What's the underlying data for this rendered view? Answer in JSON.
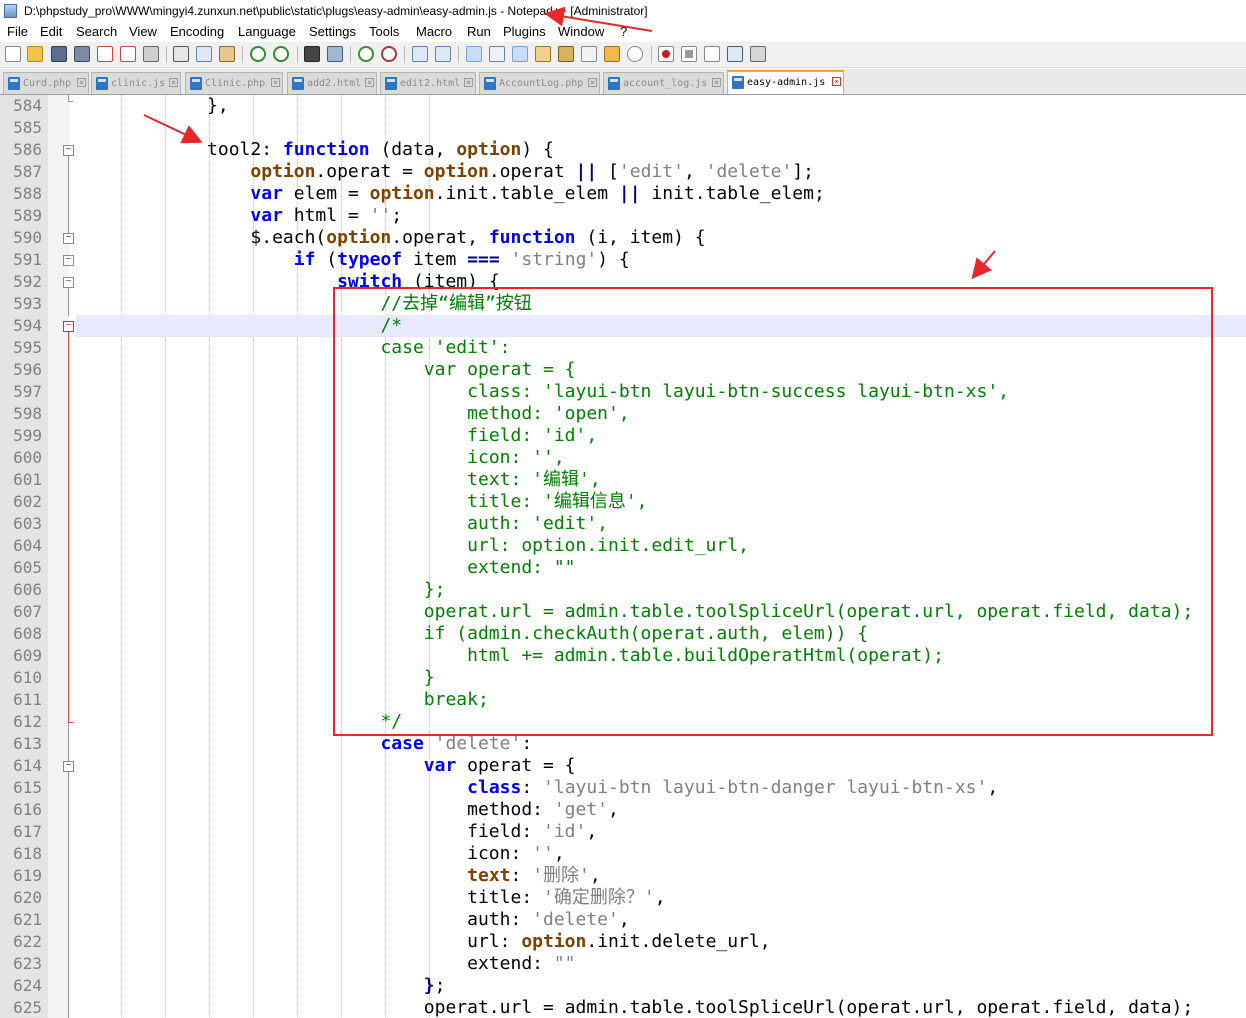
{
  "window": {
    "title": "D:\\phpstudy_pro\\WWW\\mingyi4.zunxun.net\\public\\static\\plugs\\easy-admin\\easy-admin.js - Notepad++ [Administrator]"
  },
  "menubar": {
    "items": [
      {
        "label": "File"
      },
      {
        "label": "Edit"
      },
      {
        "label": "Search"
      },
      {
        "label": "View"
      },
      {
        "label": "Encoding"
      },
      {
        "label": "Language"
      },
      {
        "label": "Settings"
      },
      {
        "label": "Tools"
      },
      {
        "label": "Macro"
      },
      {
        "label": "Run"
      },
      {
        "label": "Plugins"
      },
      {
        "label": "Window"
      },
      {
        "label": "?"
      }
    ]
  },
  "toolbar": {
    "buttons": [
      {
        "icon": "new-file-icon"
      },
      {
        "icon": "open-file-icon"
      },
      {
        "icon": "save-icon"
      },
      {
        "icon": "save-all-icon"
      },
      {
        "icon": "close-file-icon"
      },
      {
        "icon": "close-all-icon"
      },
      {
        "icon": "print-icon"
      },
      {
        "icon": "cut-icon"
      },
      {
        "icon": "copy-icon"
      },
      {
        "icon": "paste-icon"
      },
      {
        "icon": "undo-icon"
      },
      {
        "icon": "redo-icon"
      },
      {
        "icon": "find-icon"
      },
      {
        "icon": "replace-icon"
      },
      {
        "icon": "zoom-in-icon"
      },
      {
        "icon": "zoom-out-icon"
      },
      {
        "icon": "sync-vertical-icon"
      },
      {
        "icon": "sync-horizontal-icon"
      },
      {
        "icon": "word-wrap-icon"
      },
      {
        "icon": "show-all-characters-icon"
      },
      {
        "icon": "indent-guide-icon"
      },
      {
        "icon": "user-defined-language-icon"
      },
      {
        "icon": "document-map-icon"
      },
      {
        "icon": "function-list-icon"
      },
      {
        "icon": "folder-as-workspace-icon"
      },
      {
        "icon": "monitoring-icon"
      },
      {
        "icon": "record-macro-icon"
      },
      {
        "icon": "stop-recording-icon"
      },
      {
        "icon": "playback-macro-icon"
      },
      {
        "icon": "run-macro-multiple-icon"
      },
      {
        "icon": "save-macro-icon"
      }
    ]
  },
  "tabs": [
    {
      "label": "Curd.php",
      "active": false
    },
    {
      "label": "clinic.js",
      "active": false
    },
    {
      "label": "Clinic.php",
      "active": false
    },
    {
      "label": "add2.html",
      "active": false
    },
    {
      "label": "edit2.html",
      "active": false
    },
    {
      "label": "AccountLog.php",
      "active": false
    },
    {
      "label": "account_log.js",
      "active": false
    },
    {
      "label": "easy-admin.js",
      "active": true
    }
  ],
  "editor": {
    "current_line": 594,
    "lines": [
      {
        "n": "584",
        "tokens": [
          [
            "",
            "            },"
          ]
        ]
      },
      {
        "n": "585",
        "tokens": [
          [
            "",
            ""
          ]
        ]
      },
      {
        "n": "586",
        "tokens": [
          [
            "",
            "            tool2: "
          ],
          [
            "kw",
            "function"
          ],
          [
            "",
            " (data, "
          ],
          [
            "ob",
            "option"
          ],
          [
            "",
            ") {"
          ]
        ]
      },
      {
        "n": "587",
        "tokens": [
          [
            "",
            "                "
          ],
          [
            "ob",
            "option"
          ],
          [
            "",
            ".operat = "
          ],
          [
            "ob",
            "option"
          ],
          [
            "",
            ".operat "
          ],
          [
            "pn",
            "||"
          ],
          [
            "",
            " ["
          ],
          [
            "st",
            "'edit'"
          ],
          [
            "",
            ", "
          ],
          [
            "st",
            "'delete'"
          ],
          [
            "",
            "];"
          ]
        ]
      },
      {
        "n": "588",
        "tokens": [
          [
            "",
            "                "
          ],
          [
            "kw",
            "var"
          ],
          [
            "",
            " elem = "
          ],
          [
            "ob",
            "option"
          ],
          [
            "",
            ".init.table_elem "
          ],
          [
            "pn",
            "||"
          ],
          [
            "",
            " init.table_elem;"
          ]
        ]
      },
      {
        "n": "589",
        "tokens": [
          [
            "",
            "                "
          ],
          [
            "kw",
            "var"
          ],
          [
            "",
            " html = "
          ],
          [
            "st",
            "''"
          ],
          [
            "",
            ";"
          ]
        ]
      },
      {
        "n": "590",
        "tokens": [
          [
            "",
            "                $.each("
          ],
          [
            "ob",
            "option"
          ],
          [
            "",
            ".operat, "
          ],
          [
            "kw",
            "function"
          ],
          [
            "",
            " (i, item) {"
          ]
        ]
      },
      {
        "n": "591",
        "tokens": [
          [
            "",
            "                    "
          ],
          [
            "kw",
            "if"
          ],
          [
            "",
            " ("
          ],
          [
            "kw",
            "typeof"
          ],
          [
            "",
            " item "
          ],
          [
            "pn",
            "==="
          ],
          [
            "",
            " "
          ],
          [
            "st",
            "'string'"
          ],
          [
            "",
            ") {"
          ]
        ]
      },
      {
        "n": "592",
        "tokens": [
          [
            "",
            "                        "
          ],
          [
            "kw",
            "switch"
          ],
          [
            "",
            " (item) {"
          ]
        ]
      },
      {
        "n": "593",
        "tokens": [
          [
            "",
            "                            "
          ],
          [
            "cm",
            "//去掉“编辑”按钮"
          ]
        ]
      },
      {
        "n": "594",
        "tokens": [
          [
            "",
            "                            "
          ],
          [
            "cm",
            "/*"
          ]
        ]
      },
      {
        "n": "595",
        "tokens": [
          [
            "",
            "                            "
          ],
          [
            "cm",
            "case 'edit':"
          ]
        ]
      },
      {
        "n": "596",
        "tokens": [
          [
            "",
            "                                "
          ],
          [
            "cm",
            "var operat = {"
          ]
        ]
      },
      {
        "n": "597",
        "tokens": [
          [
            "",
            "                                    "
          ],
          [
            "cm",
            "class: 'layui-btn layui-btn-success layui-btn-xs',"
          ]
        ]
      },
      {
        "n": "598",
        "tokens": [
          [
            "",
            "                                    "
          ],
          [
            "cm",
            "method: 'open',"
          ]
        ]
      },
      {
        "n": "599",
        "tokens": [
          [
            "",
            "                                    "
          ],
          [
            "cm",
            "field: 'id',"
          ]
        ]
      },
      {
        "n": "600",
        "tokens": [
          [
            "",
            "                                    "
          ],
          [
            "cm",
            "icon: '',"
          ]
        ]
      },
      {
        "n": "601",
        "tokens": [
          [
            "",
            "                                    "
          ],
          [
            "cm",
            "text: '编辑',"
          ]
        ]
      },
      {
        "n": "602",
        "tokens": [
          [
            "",
            "                                    "
          ],
          [
            "cm",
            "title: '编辑信息',"
          ]
        ]
      },
      {
        "n": "603",
        "tokens": [
          [
            "",
            "                                    "
          ],
          [
            "cm",
            "auth: 'edit',"
          ]
        ]
      },
      {
        "n": "604",
        "tokens": [
          [
            "",
            "                                    "
          ],
          [
            "cm",
            "url: option.init.edit_url,"
          ]
        ]
      },
      {
        "n": "605",
        "tokens": [
          [
            "",
            "                                    "
          ],
          [
            "cm",
            "extend: \"\""
          ]
        ]
      },
      {
        "n": "606",
        "tokens": [
          [
            "",
            "                                "
          ],
          [
            "cm",
            "};"
          ]
        ]
      },
      {
        "n": "607",
        "tokens": [
          [
            "",
            "                                "
          ],
          [
            "cm",
            "operat.url = admin.table.toolSpliceUrl(operat.url, operat.field, data);"
          ]
        ]
      },
      {
        "n": "608",
        "tokens": [
          [
            "",
            "                                "
          ],
          [
            "cm",
            "if (admin.checkAuth(operat.auth, elem)) {"
          ]
        ]
      },
      {
        "n": "609",
        "tokens": [
          [
            "",
            "                                    "
          ],
          [
            "cm",
            "html += admin.table.buildOperatHtml(operat);"
          ]
        ]
      },
      {
        "n": "610",
        "tokens": [
          [
            "",
            "                                "
          ],
          [
            "cm",
            "}"
          ]
        ]
      },
      {
        "n": "611",
        "tokens": [
          [
            "",
            "                                "
          ],
          [
            "cm",
            "break;"
          ]
        ]
      },
      {
        "n": "612",
        "tokens": [
          [
            "",
            "                            "
          ],
          [
            "cm",
            "*/"
          ]
        ]
      },
      {
        "n": "613",
        "tokens": [
          [
            "",
            "                            "
          ],
          [
            "kw",
            "case"
          ],
          [
            "",
            " "
          ],
          [
            "st",
            "'delete'"
          ],
          [
            "",
            ":"
          ]
        ]
      },
      {
        "n": "614",
        "tokens": [
          [
            "",
            "                                "
          ],
          [
            "kw",
            "var"
          ],
          [
            "",
            " operat = {"
          ]
        ]
      },
      {
        "n": "615",
        "tokens": [
          [
            "",
            "                                    "
          ],
          [
            "kw",
            "class"
          ],
          [
            "",
            ": "
          ],
          [
            "st",
            "'layui-btn layui-btn-danger layui-btn-xs'"
          ],
          [
            "",
            ","
          ]
        ]
      },
      {
        "n": "616",
        "tokens": [
          [
            "",
            "                                    method: "
          ],
          [
            "st",
            "'get'"
          ],
          [
            "",
            ","
          ]
        ]
      },
      {
        "n": "617",
        "tokens": [
          [
            "",
            "                                    field: "
          ],
          [
            "st",
            "'id'"
          ],
          [
            "",
            ","
          ]
        ]
      },
      {
        "n": "618",
        "tokens": [
          [
            "",
            "                                    icon: "
          ],
          [
            "st",
            "''"
          ],
          [
            "",
            ","
          ]
        ]
      },
      {
        "n": "619",
        "tokens": [
          [
            "",
            "                                    "
          ],
          [
            "ob",
            "text"
          ],
          [
            "",
            ": "
          ],
          [
            "st",
            "'删除'"
          ],
          [
            "",
            ","
          ]
        ]
      },
      {
        "n": "620",
        "tokens": [
          [
            "",
            "                                    title: "
          ],
          [
            "st",
            "'确定删除？'"
          ],
          [
            "",
            ","
          ]
        ]
      },
      {
        "n": "621",
        "tokens": [
          [
            "",
            "                                    auth: "
          ],
          [
            "st",
            "'delete'"
          ],
          [
            "",
            ","
          ]
        ]
      },
      {
        "n": "622",
        "tokens": [
          [
            "",
            "                                    url: "
          ],
          [
            "ob",
            "option"
          ],
          [
            "",
            ".init.delete_url,"
          ]
        ]
      },
      {
        "n": "623",
        "tokens": [
          [
            "",
            "                                    extend: "
          ],
          [
            "st",
            "\"\""
          ]
        ]
      },
      {
        "n": "624",
        "tokens": [
          [
            "",
            "                                "
          ],
          [
            "pn",
            "}"
          ],
          [
            "",
            ";"
          ]
        ]
      },
      {
        "n": "625",
        "tokens": [
          [
            "",
            "                                operat.url = admin.table.toolSpliceUrl(operat.url, operat.field, data);"
          ]
        ]
      }
    ]
  },
  "colors": {
    "keyword": "#0000ff",
    "string": "#808080",
    "comment": "#008000",
    "object": "#804000",
    "annotation": "#e8262b",
    "current_line": "#e8e8ff"
  }
}
